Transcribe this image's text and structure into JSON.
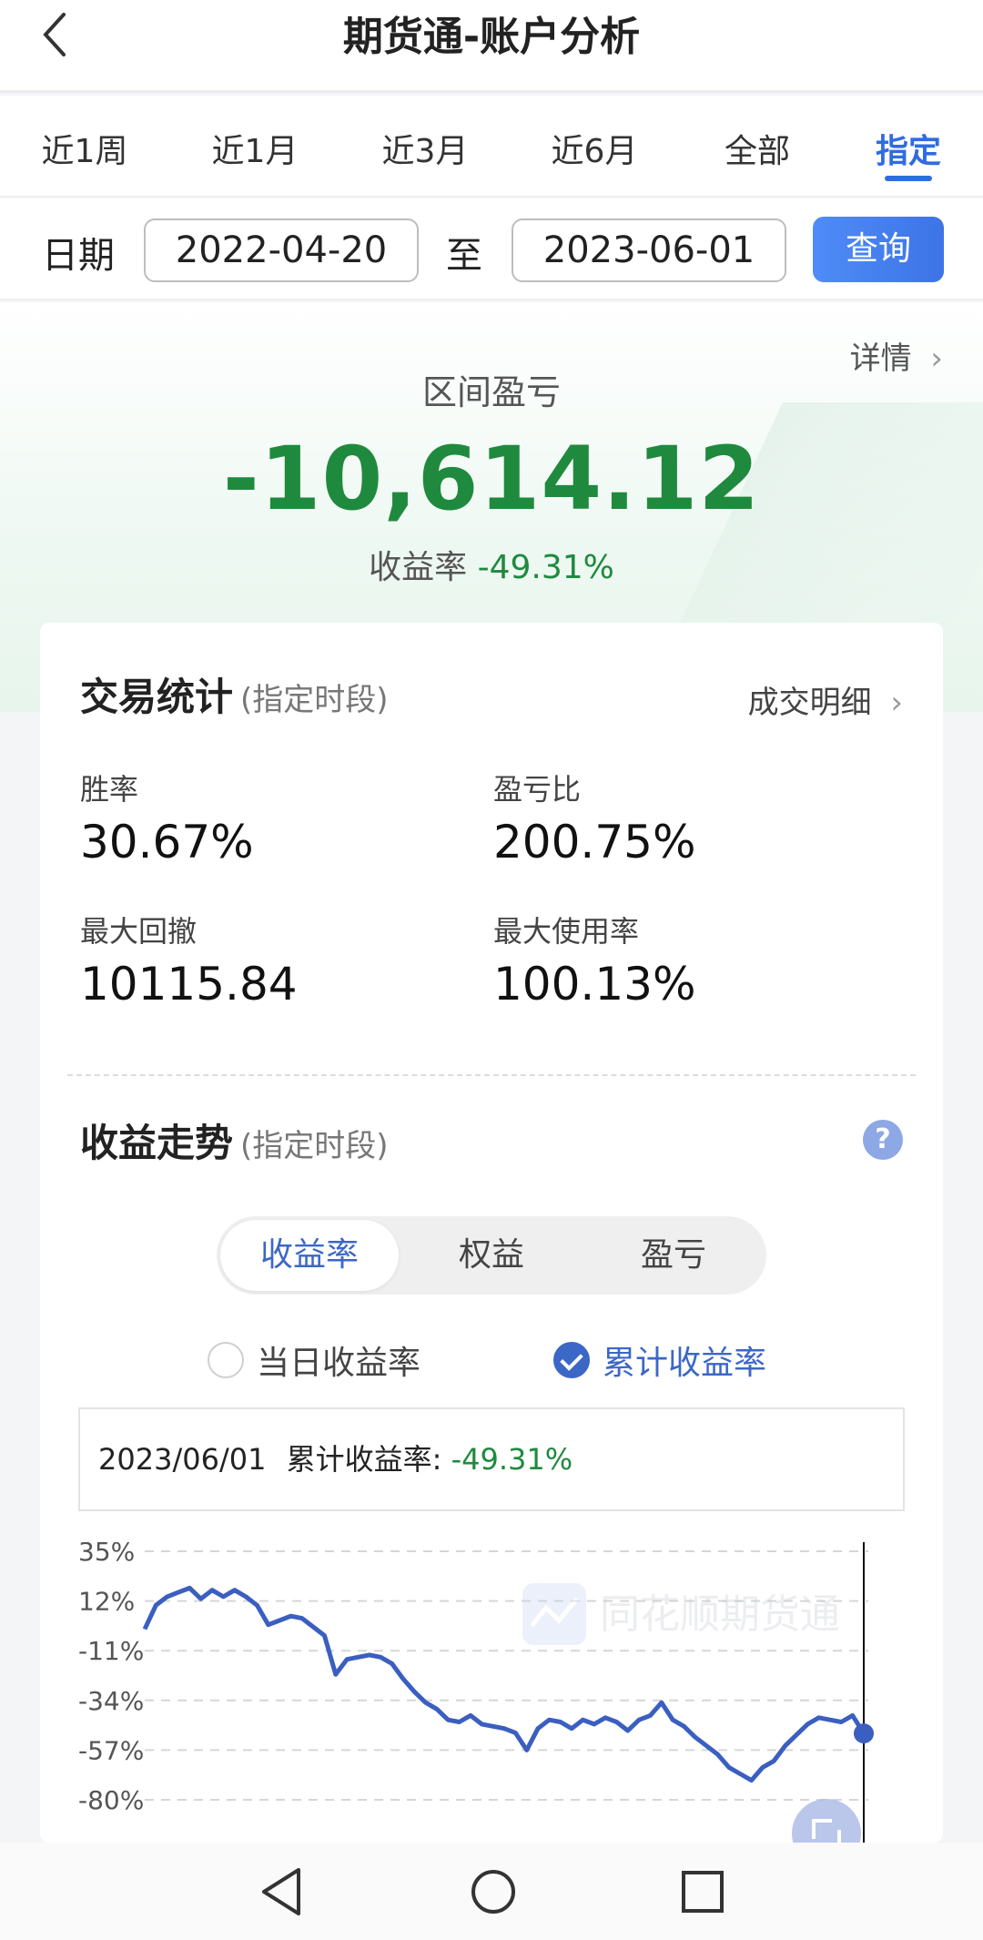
{
  "header": {
    "title": "期货通-账户分析"
  },
  "tabs": [
    {
      "label": "近1周"
    },
    {
      "label": "近1月"
    },
    {
      "label": "近3月"
    },
    {
      "label": "近6月"
    },
    {
      "label": "全部"
    },
    {
      "label": "指定"
    }
  ],
  "date_filter": {
    "label": "日期",
    "start": "2022-04-20",
    "separator": "至",
    "end": "2023-06-01",
    "query_label": "查询"
  },
  "summary": {
    "detail_link": "详情",
    "pl_label": "区间盈亏",
    "pl_value": "-10,614.12",
    "rate_label": "收益率",
    "rate_value": "-49.31%"
  },
  "trade_stats": {
    "title": "交易统计",
    "subtitle": "(指定时段)",
    "link": "成交明细",
    "win_rate_label": "胜率",
    "win_rate_value": "30.67%",
    "pl_ratio_label": "盈亏比",
    "pl_ratio_value": "200.75%",
    "max_drawdown_label": "最大回撤",
    "max_drawdown_value": "10115.84",
    "max_usage_label": "最大使用率",
    "max_usage_value": "100.13%"
  },
  "trend": {
    "title": "收益走势",
    "subtitle": "(指定时段)",
    "help_icon": "?",
    "segments": [
      "收益率",
      "权益",
      "盈亏"
    ],
    "active_segment": "收益率",
    "radio_daily": "当日收益率",
    "radio_cumulative": "累计收益率",
    "selected_radio": "累计收益率",
    "tooltip_date": "2023/06/01",
    "tooltip_label": "累计收益率:",
    "tooltip_value": "-49.31%",
    "watermark": "同花顺期货通"
  },
  "colors": {
    "accent": "#2f6ce0",
    "loss_green": "#1f8a3e",
    "line": "#3b5fc0"
  },
  "chart_data": {
    "type": "line",
    "ylabels": [
      "35%",
      "12%",
      "-11%",
      "-34%",
      "-57%",
      "-80%"
    ],
    "ylim": [
      -80,
      35
    ],
    "grid": true,
    "series": [
      {
        "values": [
          -1,
          10,
          14,
          16,
          18,
          13,
          17,
          14,
          17,
          14,
          10,
          1,
          3,
          5,
          4,
          0,
          -4,
          -22,
          -15,
          -14,
          -13,
          -14,
          -17,
          -24,
          -30,
          -35,
          -38,
          -43,
          -44,
          -41,
          -45,
          -46,
          -47,
          -49,
          -57,
          -47,
          -43,
          -44,
          -47,
          -43,
          -45,
          -42,
          -44,
          -48,
          -43,
          -41,
          -35,
          -43,
          -46,
          -51,
          -55,
          -59,
          -65,
          -68,
          -71,
          -65,
          -62,
          -55,
          -50,
          -45,
          -42,
          -43,
          -44,
          -41,
          -49.31
        ]
      }
    ]
  }
}
